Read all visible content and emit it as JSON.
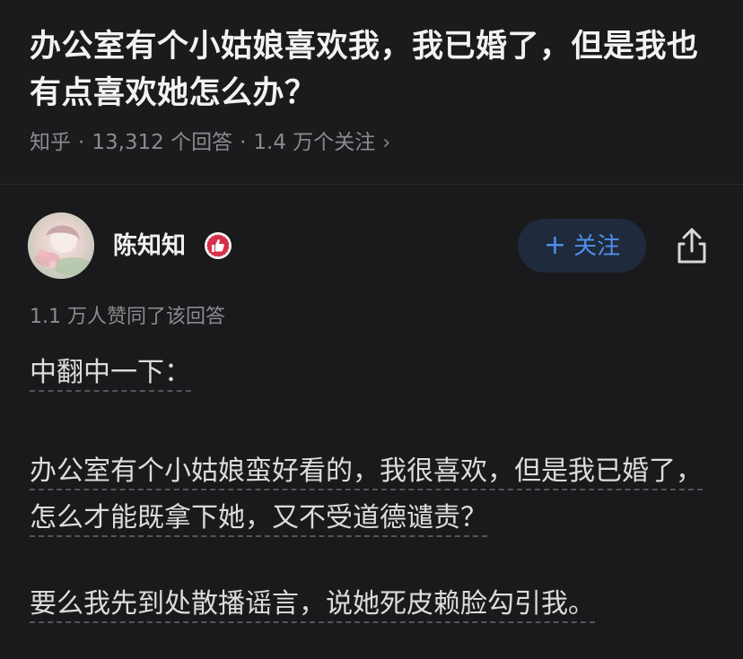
{
  "question": {
    "title": "办公室有个小姑娘喜欢我，我已婚了，但是我也有点喜欢她怎么办？",
    "source": "知乎",
    "answers_count": "13,312 个回答",
    "followers": "1.4 万个关注",
    "chevron": "chevron-right-icon"
  },
  "answer": {
    "author": {
      "name": "陈知知",
      "badge_icon": "thumbs-up-badge-icon",
      "avatar_icon": "avatar"
    },
    "follow_button": {
      "label": "关注",
      "icon": "plus-icon"
    },
    "share_icon": "share-icon",
    "upvote_info": "1.1 万人赞同了该回答",
    "paragraphs": [
      "中翻中一下：",
      "办公室有个小姑娘蛮好看的，我很喜欢，但是我已婚了，怎么才能既拿下她，又不受道德谴责？",
      "要么我先到处散播谣言，说她死皮赖脸勾引我。"
    ]
  },
  "colors": {
    "background": "#1a1a1c",
    "accent": "#4f8fea",
    "follow_bg": "#1f2a3c",
    "muted_text": "#8b8b8f",
    "badge_red": "#d6314a"
  }
}
